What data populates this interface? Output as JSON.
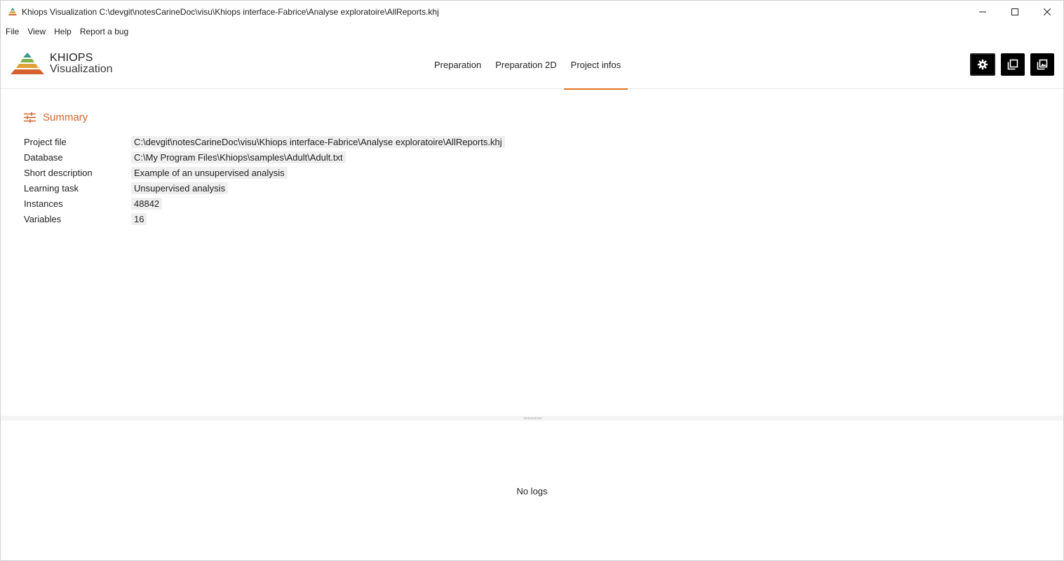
{
  "window": {
    "title": "Khiops Visualization C:\\devgit\\notesCarineDoc\\visu\\Khiops interface-Fabrice\\Analyse exploratoire\\AllReports.khj",
    "controls": [
      "minimize-icon",
      "maximize-icon",
      "close-icon"
    ]
  },
  "menu": {
    "items": [
      {
        "label": "File"
      },
      {
        "label": "View"
      },
      {
        "label": "Help"
      },
      {
        "label": "Report a bug"
      }
    ]
  },
  "header": {
    "logo_title": "KHIOPS",
    "logo_subtitle": "Visualization",
    "tabs": [
      {
        "label": "Preparation",
        "active": false
      },
      {
        "label": "Preparation 2D",
        "active": false
      },
      {
        "label": "Project infos",
        "active": true
      }
    ],
    "actions": [
      "settings-icon",
      "copy-icon",
      "image-icon"
    ],
    "accent_color": "#e2731f"
  },
  "summary": {
    "title": "Summary",
    "icon": "tune-icon",
    "title_color": "#d5622d",
    "rows": [
      {
        "label": "Project file",
        "value": "C:\\devgit\\notesCarineDoc\\visu\\Khiops interface-Fabrice\\Analyse exploratoire\\AllReports.khj"
      },
      {
        "label": "Database",
        "value": "C:\\My Program Files\\Khiops\\samples\\Adult\\Adult.txt"
      },
      {
        "label": "Short description",
        "value": "Example of an unsupervised analysis"
      },
      {
        "label": "Learning task",
        "value": "Unsupervised analysis"
      },
      {
        "label": "Instances",
        "value": "48842"
      },
      {
        "label": "Variables",
        "value": "16"
      }
    ]
  },
  "logs": {
    "empty_text": "No logs"
  }
}
